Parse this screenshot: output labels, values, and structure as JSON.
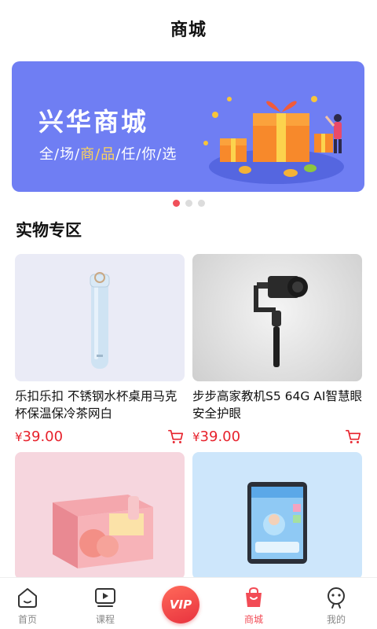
{
  "header": {
    "title": "商城"
  },
  "banner": {
    "title": "兴华商城",
    "subtitle_parts": [
      "全/场/",
      "商/品",
      "/任/你/选"
    ]
  },
  "carousel": {
    "count": 3,
    "active_index": 0
  },
  "section": {
    "title": "实物专区"
  },
  "products": [
    {
      "name": "乐扣乐扣 不锈钢水杯桌用马克杯保温保冷茶网白",
      "currency": "¥",
      "price": "39.00"
    },
    {
      "name": "步步高家教机S5 64G AI智慧眼 安全护眼",
      "currency": "¥",
      "price": "39.00"
    },
    {
      "name": "",
      "currency": "",
      "price": ""
    },
    {
      "name": "",
      "currency": "",
      "price": ""
    }
  ],
  "tabs": [
    {
      "label": "首页",
      "icon": "home-icon"
    },
    {
      "label": "课程",
      "icon": "play-icon"
    },
    {
      "label": "VIP",
      "icon": "vip-icon"
    },
    {
      "label": "商城",
      "icon": "shopping-bag-icon"
    },
    {
      "label": "我的",
      "icon": "profile-icon"
    }
  ],
  "colors": {
    "accent": "#f24b55",
    "price": "#e7222c",
    "banner_bg": "#6f7ef3"
  }
}
